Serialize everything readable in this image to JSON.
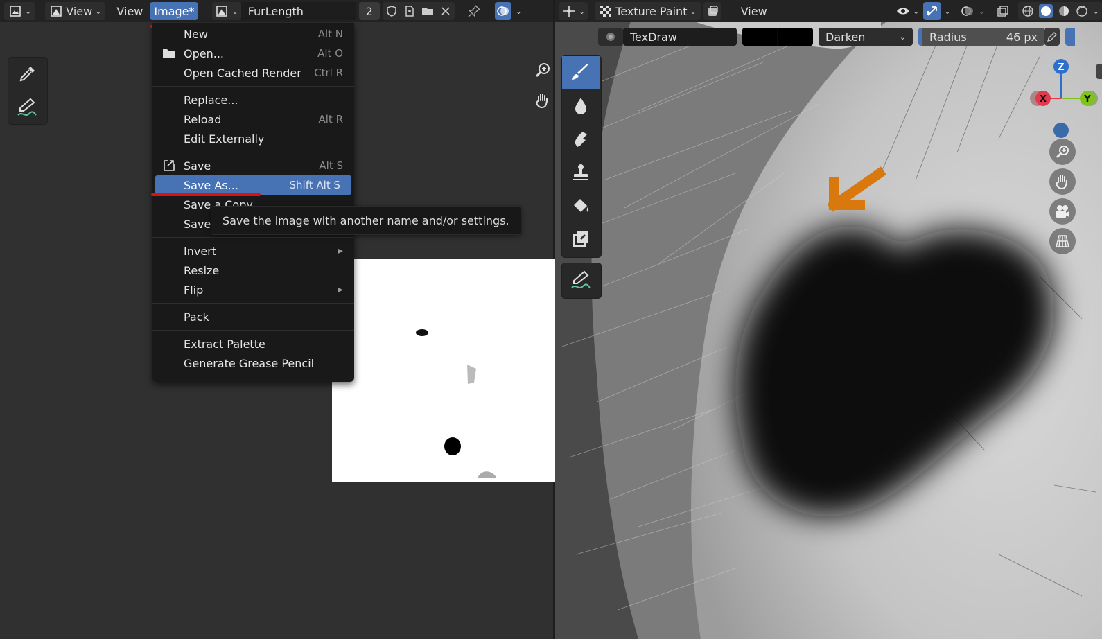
{
  "left_header": {
    "view_menu_1": "View",
    "view_menu_2": "View",
    "image_menu": "Image*",
    "image_name": "FurLength",
    "user_count": "2"
  },
  "image_menu": {
    "items": [
      {
        "label": "New",
        "shortcut": "Alt N"
      },
      {
        "label": "Open...",
        "shortcut": "Alt O"
      },
      {
        "label": "Open Cached Render",
        "shortcut": "Ctrl R"
      },
      {
        "label": "Replace...",
        "shortcut": ""
      },
      {
        "label": "Reload",
        "shortcut": "Alt R"
      },
      {
        "label": "Edit Externally",
        "shortcut": ""
      },
      {
        "label": "Save",
        "shortcut": "Alt S"
      },
      {
        "label": "Save As...",
        "shortcut": "Shift Alt S"
      },
      {
        "label": "Save a Copy",
        "shortcut": ""
      },
      {
        "label": "Save",
        "shortcut": ""
      },
      {
        "label": "Invert",
        "shortcut": ""
      },
      {
        "label": "Resize",
        "shortcut": ""
      },
      {
        "label": "Flip",
        "shortcut": ""
      },
      {
        "label": "Pack",
        "shortcut": ""
      },
      {
        "label": "Extract Palette",
        "shortcut": ""
      },
      {
        "label": "Generate Grease Pencil",
        "shortcut": ""
      }
    ]
  },
  "tooltip": "Save the image with another name and/or settings.",
  "right_header": {
    "mode": "Texture Paint",
    "view_menu": "View",
    "brush_name": "TexDraw",
    "blend_mode": "Darken",
    "radius_label": "Radius",
    "radius_value": "46 px"
  },
  "gizmo": {
    "x": "X",
    "y": "Y",
    "z": "Z"
  },
  "colors": {
    "accent": "#4772b3",
    "annotation_red": "#e01010",
    "annotation_arrow": "#d9780d",
    "gizmo_x": "#e23a4d",
    "gizmo_y": "#7fc31c",
    "gizmo_z": "#2c6fcf"
  }
}
